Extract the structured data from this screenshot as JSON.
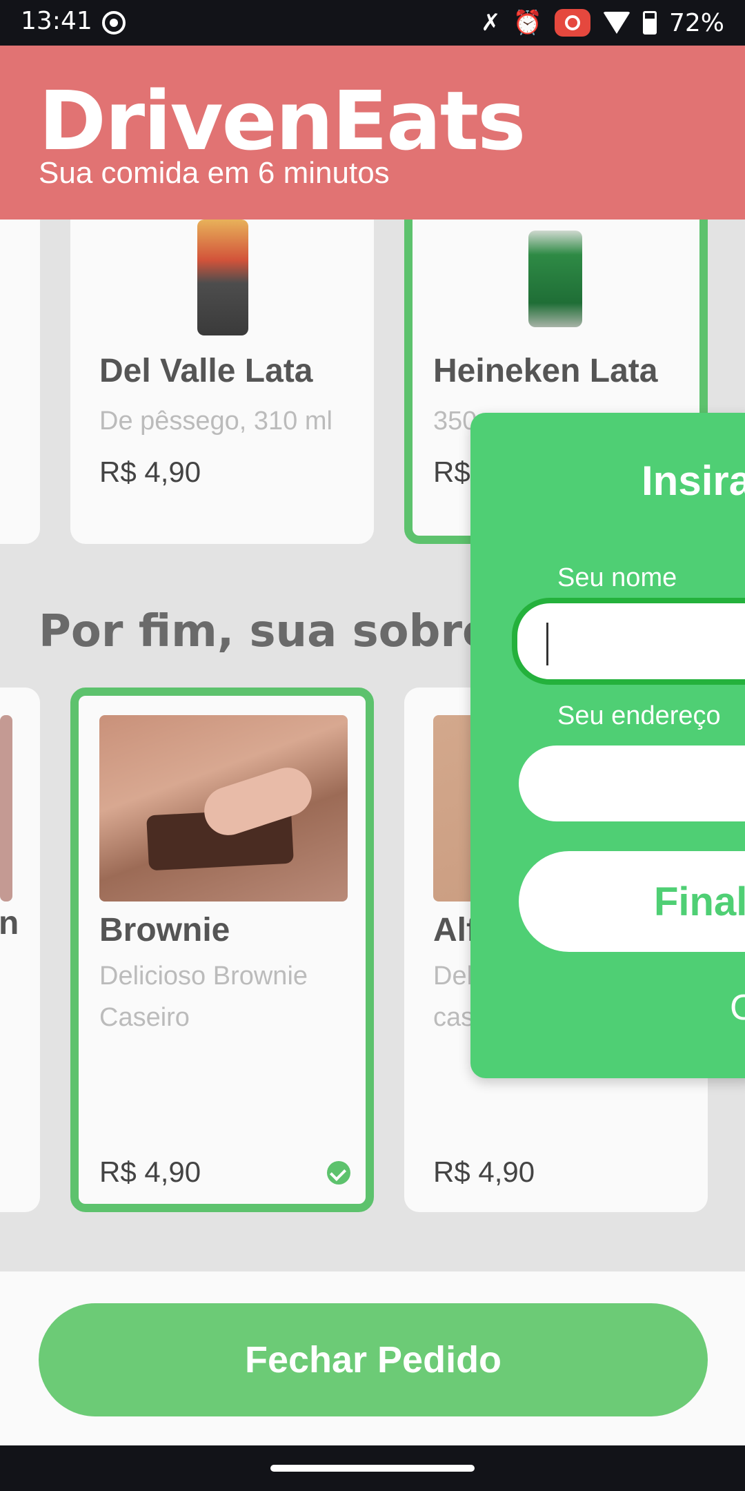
{
  "status_bar": {
    "time": "13:41",
    "battery_percent": "72%",
    "icons": [
      "location-icon",
      "mute-icon",
      "alarm-icon",
      "screen-record-icon",
      "wifi-icon",
      "battery-icon"
    ]
  },
  "header": {
    "app_name": "DrivenEats",
    "tagline": "Sua comida em 6 minutos"
  },
  "drinks": [
    {
      "title": "Del Valle Lata",
      "description": "De pêssego, 310 ml",
      "price": "R$ 4,90",
      "selected": false
    },
    {
      "title": "Heineken Lata",
      "description": "350",
      "price": "R$",
      "selected": true
    }
  ],
  "desserts_section": {
    "title": "Por fim, sua sobrer"
  },
  "desserts": [
    {
      "title": "Brownie",
      "description_line1": "Delicioso Brownie",
      "description_line2": "Caseiro",
      "price": "R$ 4,90",
      "selected": true
    },
    {
      "title": "Alf",
      "description_line1": "Del",
      "description_line2": "cas",
      "price": "R$ 4,90",
      "selected": false
    }
  ],
  "left_partial_letter": "n",
  "footer": {
    "checkout_label": "Fechar Pedido"
  },
  "modal": {
    "title": "Insira",
    "name_label": "Seu nome",
    "name_value": "",
    "address_label": "Seu endereço",
    "address_value": "",
    "submit_label": "Final",
    "cancel_label": "C"
  },
  "colors": {
    "header": "#e17373",
    "accent_green": "#5dc26d",
    "modal_green": "#4fcf74",
    "checkout_green": "#6ccb76"
  }
}
